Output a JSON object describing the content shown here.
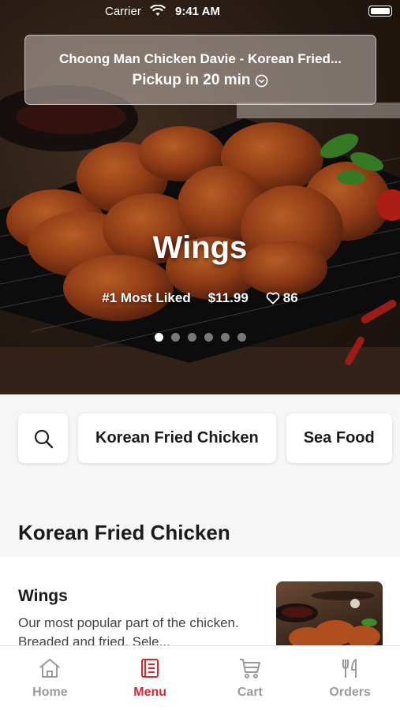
{
  "status_bar": {
    "carrier": "Carrier",
    "time": "9:41 AM"
  },
  "store": {
    "name": "Choong Man Chicken Davie - Korean Fried...",
    "pickup": "Pickup in 20 min"
  },
  "hero": {
    "title": "Wings",
    "rank": "#1 Most Liked",
    "price": "$11.99",
    "likes": "86",
    "slides_total": 6,
    "slide_active": 1
  },
  "categories": {
    "search_icon": "search-icon",
    "items": [
      "Korean Fried Chicken",
      "Sea Food"
    ]
  },
  "section": {
    "title": "Korean Fried Chicken"
  },
  "menu_items": [
    {
      "name": "Wings",
      "description": "Our most popular part of the chicken. Breaded and fried. Sele..."
    }
  ],
  "tab_bar": {
    "active": "Menu",
    "tabs": [
      {
        "label": "Home",
        "icon": "home-icon"
      },
      {
        "label": "Menu",
        "icon": "menu-book-icon"
      },
      {
        "label": "Cart",
        "icon": "cart-icon"
      },
      {
        "label": "Orders",
        "icon": "fork-knife-icon"
      }
    ]
  },
  "colors": {
    "accent": "#d9272e",
    "inactive_tab": "#9a9a9a"
  }
}
